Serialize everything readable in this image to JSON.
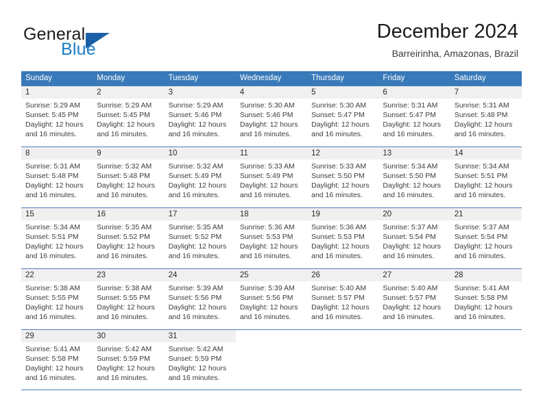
{
  "logo": {
    "text_primary": "General",
    "text_secondary": "Blue",
    "icon": "triangle-logo-icon",
    "color_primary": "#1b1b1b",
    "color_secondary": "#1a7cc4",
    "color_triangle": "#1b5fa8"
  },
  "header": {
    "title": "December 2024",
    "location": "Barreirinha, Amazonas, Brazil"
  },
  "colors": {
    "header_blue": "#3879b9",
    "daynum_band": "#f0f0f0",
    "row_divider": "#4a7fb5",
    "text": "#3c3c3c"
  },
  "weekdays": [
    "Sunday",
    "Monday",
    "Tuesday",
    "Wednesday",
    "Thursday",
    "Friday",
    "Saturday"
  ],
  "weeks": [
    [
      {
        "day": "1",
        "sunrise": "Sunrise: 5:29 AM",
        "sunset": "Sunset: 5:45 PM",
        "daylight1": "Daylight: 12 hours",
        "daylight2": "and 16 minutes."
      },
      {
        "day": "2",
        "sunrise": "Sunrise: 5:29 AM",
        "sunset": "Sunset: 5:45 PM",
        "daylight1": "Daylight: 12 hours",
        "daylight2": "and 16 minutes."
      },
      {
        "day": "3",
        "sunrise": "Sunrise: 5:29 AM",
        "sunset": "Sunset: 5:46 PM",
        "daylight1": "Daylight: 12 hours",
        "daylight2": "and 16 minutes."
      },
      {
        "day": "4",
        "sunrise": "Sunrise: 5:30 AM",
        "sunset": "Sunset: 5:46 PM",
        "daylight1": "Daylight: 12 hours",
        "daylight2": "and 16 minutes."
      },
      {
        "day": "5",
        "sunrise": "Sunrise: 5:30 AM",
        "sunset": "Sunset: 5:47 PM",
        "daylight1": "Daylight: 12 hours",
        "daylight2": "and 16 minutes."
      },
      {
        "day": "6",
        "sunrise": "Sunrise: 5:31 AM",
        "sunset": "Sunset: 5:47 PM",
        "daylight1": "Daylight: 12 hours",
        "daylight2": "and 16 minutes."
      },
      {
        "day": "7",
        "sunrise": "Sunrise: 5:31 AM",
        "sunset": "Sunset: 5:48 PM",
        "daylight1": "Daylight: 12 hours",
        "daylight2": "and 16 minutes."
      }
    ],
    [
      {
        "day": "8",
        "sunrise": "Sunrise: 5:31 AM",
        "sunset": "Sunset: 5:48 PM",
        "daylight1": "Daylight: 12 hours",
        "daylight2": "and 16 minutes."
      },
      {
        "day": "9",
        "sunrise": "Sunrise: 5:32 AM",
        "sunset": "Sunset: 5:48 PM",
        "daylight1": "Daylight: 12 hours",
        "daylight2": "and 16 minutes."
      },
      {
        "day": "10",
        "sunrise": "Sunrise: 5:32 AM",
        "sunset": "Sunset: 5:49 PM",
        "daylight1": "Daylight: 12 hours",
        "daylight2": "and 16 minutes."
      },
      {
        "day": "11",
        "sunrise": "Sunrise: 5:33 AM",
        "sunset": "Sunset: 5:49 PM",
        "daylight1": "Daylight: 12 hours",
        "daylight2": "and 16 minutes."
      },
      {
        "day": "12",
        "sunrise": "Sunrise: 5:33 AM",
        "sunset": "Sunset: 5:50 PM",
        "daylight1": "Daylight: 12 hours",
        "daylight2": "and 16 minutes."
      },
      {
        "day": "13",
        "sunrise": "Sunrise: 5:34 AM",
        "sunset": "Sunset: 5:50 PM",
        "daylight1": "Daylight: 12 hours",
        "daylight2": "and 16 minutes."
      },
      {
        "day": "14",
        "sunrise": "Sunrise: 5:34 AM",
        "sunset": "Sunset: 5:51 PM",
        "daylight1": "Daylight: 12 hours",
        "daylight2": "and 16 minutes."
      }
    ],
    [
      {
        "day": "15",
        "sunrise": "Sunrise: 5:34 AM",
        "sunset": "Sunset: 5:51 PM",
        "daylight1": "Daylight: 12 hours",
        "daylight2": "and 16 minutes."
      },
      {
        "day": "16",
        "sunrise": "Sunrise: 5:35 AM",
        "sunset": "Sunset: 5:52 PM",
        "daylight1": "Daylight: 12 hours",
        "daylight2": "and 16 minutes."
      },
      {
        "day": "17",
        "sunrise": "Sunrise: 5:35 AM",
        "sunset": "Sunset: 5:52 PM",
        "daylight1": "Daylight: 12 hours",
        "daylight2": "and 16 minutes."
      },
      {
        "day": "18",
        "sunrise": "Sunrise: 5:36 AM",
        "sunset": "Sunset: 5:53 PM",
        "daylight1": "Daylight: 12 hours",
        "daylight2": "and 16 minutes."
      },
      {
        "day": "19",
        "sunrise": "Sunrise: 5:36 AM",
        "sunset": "Sunset: 5:53 PM",
        "daylight1": "Daylight: 12 hours",
        "daylight2": "and 16 minutes."
      },
      {
        "day": "20",
        "sunrise": "Sunrise: 5:37 AM",
        "sunset": "Sunset: 5:54 PM",
        "daylight1": "Daylight: 12 hours",
        "daylight2": "and 16 minutes."
      },
      {
        "day": "21",
        "sunrise": "Sunrise: 5:37 AM",
        "sunset": "Sunset: 5:54 PM",
        "daylight1": "Daylight: 12 hours",
        "daylight2": "and 16 minutes."
      }
    ],
    [
      {
        "day": "22",
        "sunrise": "Sunrise: 5:38 AM",
        "sunset": "Sunset: 5:55 PM",
        "daylight1": "Daylight: 12 hours",
        "daylight2": "and 16 minutes."
      },
      {
        "day": "23",
        "sunrise": "Sunrise: 5:38 AM",
        "sunset": "Sunset: 5:55 PM",
        "daylight1": "Daylight: 12 hours",
        "daylight2": "and 16 minutes."
      },
      {
        "day": "24",
        "sunrise": "Sunrise: 5:39 AM",
        "sunset": "Sunset: 5:56 PM",
        "daylight1": "Daylight: 12 hours",
        "daylight2": "and 16 minutes."
      },
      {
        "day": "25",
        "sunrise": "Sunrise: 5:39 AM",
        "sunset": "Sunset: 5:56 PM",
        "daylight1": "Daylight: 12 hours",
        "daylight2": "and 16 minutes."
      },
      {
        "day": "26",
        "sunrise": "Sunrise: 5:40 AM",
        "sunset": "Sunset: 5:57 PM",
        "daylight1": "Daylight: 12 hours",
        "daylight2": "and 16 minutes."
      },
      {
        "day": "27",
        "sunrise": "Sunrise: 5:40 AM",
        "sunset": "Sunset: 5:57 PM",
        "daylight1": "Daylight: 12 hours",
        "daylight2": "and 16 minutes."
      },
      {
        "day": "28",
        "sunrise": "Sunrise: 5:41 AM",
        "sunset": "Sunset: 5:58 PM",
        "daylight1": "Daylight: 12 hours",
        "daylight2": "and 16 minutes."
      }
    ],
    [
      {
        "day": "29",
        "sunrise": "Sunrise: 5:41 AM",
        "sunset": "Sunset: 5:58 PM",
        "daylight1": "Daylight: 12 hours",
        "daylight2": "and 16 minutes."
      },
      {
        "day": "30",
        "sunrise": "Sunrise: 5:42 AM",
        "sunset": "Sunset: 5:59 PM",
        "daylight1": "Daylight: 12 hours",
        "daylight2": "and 16 minutes."
      },
      {
        "day": "31",
        "sunrise": "Sunrise: 5:42 AM",
        "sunset": "Sunset: 5:59 PM",
        "daylight1": "Daylight: 12 hours",
        "daylight2": "and 16 minutes."
      },
      {
        "day": "",
        "sunrise": "",
        "sunset": "",
        "daylight1": "",
        "daylight2": ""
      },
      {
        "day": "",
        "sunrise": "",
        "sunset": "",
        "daylight1": "",
        "daylight2": ""
      },
      {
        "day": "",
        "sunrise": "",
        "sunset": "",
        "daylight1": "",
        "daylight2": ""
      },
      {
        "day": "",
        "sunrise": "",
        "sunset": "",
        "daylight1": "",
        "daylight2": ""
      }
    ]
  ]
}
